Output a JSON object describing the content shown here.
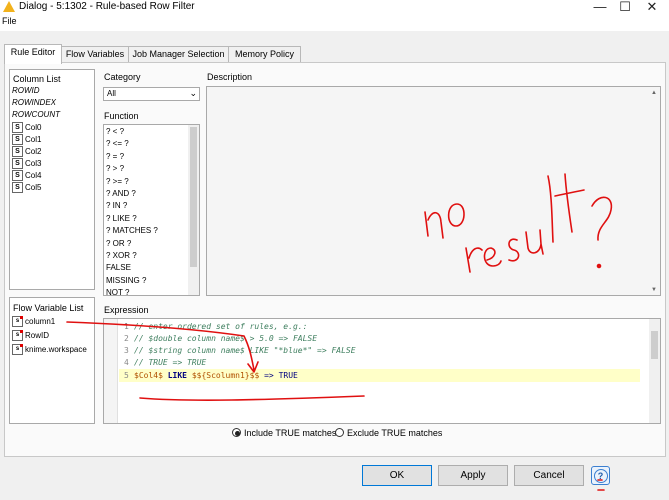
{
  "window": {
    "title": "Dialog - 5:1302 - Rule-based Row Filter",
    "minimize": "—",
    "maximize": "☐",
    "close": "✕"
  },
  "menu": {
    "file": "File"
  },
  "tabs": [
    "Rule Editor",
    "Flow Variables",
    "Job Manager Selection",
    "Memory Policy"
  ],
  "column_list": {
    "title": "Column List",
    "special": [
      "ROWID",
      "ROWINDEX",
      "ROWCOUNT"
    ],
    "columns": [
      "Col0",
      "Col1",
      "Col2",
      "Col3",
      "Col4",
      "Col5"
    ],
    "type_badge": "S"
  },
  "flow_variable_list": {
    "title": "Flow Variable List",
    "items": [
      "column1",
      "RowID",
      "knime.workspace"
    ],
    "type_badge": "s"
  },
  "category": {
    "label": "Category",
    "value": "All"
  },
  "function": {
    "label": "Function",
    "items": [
      "? < ?",
      "? <= ?",
      "? = ?",
      "? > ?",
      "? >= ?",
      "? AND ?",
      "? IN ?",
      "? LIKE ?",
      "? MATCHES ?",
      "? OR ?",
      "? XOR ?",
      "FALSE",
      "MISSING ?",
      "NOT ?"
    ]
  },
  "description": {
    "label": "Description"
  },
  "expression": {
    "label": "Expression",
    "line_numbers": [
      "1",
      "2",
      "3",
      "4",
      "5"
    ],
    "lines": [
      "// enter ordered set of rules, e.g.:",
      "// $double column name$ > 5.0 => FALSE",
      "// $string column name$ LIKE \"*blue*\" => FALSE",
      "// TRUE => TRUE"
    ],
    "rule": {
      "col": "$Col4$",
      "like": "LIKE",
      "var": "$${Scolumn1}$$",
      "arrow": "=>",
      "value": "TRUE"
    }
  },
  "options": {
    "include": "Include TRUE matches",
    "exclude": "Exclude TRUE matches",
    "selected": "include"
  },
  "buttons": {
    "ok": "OK",
    "apply": "Apply",
    "cancel": "Cancel",
    "help": "?"
  },
  "annotation": {
    "text": "no result?",
    "color": "#e01010"
  },
  "colors": {
    "comment": "#3f7f5f",
    "keyword": "#00007f",
    "flowvar": "#b05000",
    "highlight": "#ffffc8",
    "accent": "#0078d7"
  }
}
